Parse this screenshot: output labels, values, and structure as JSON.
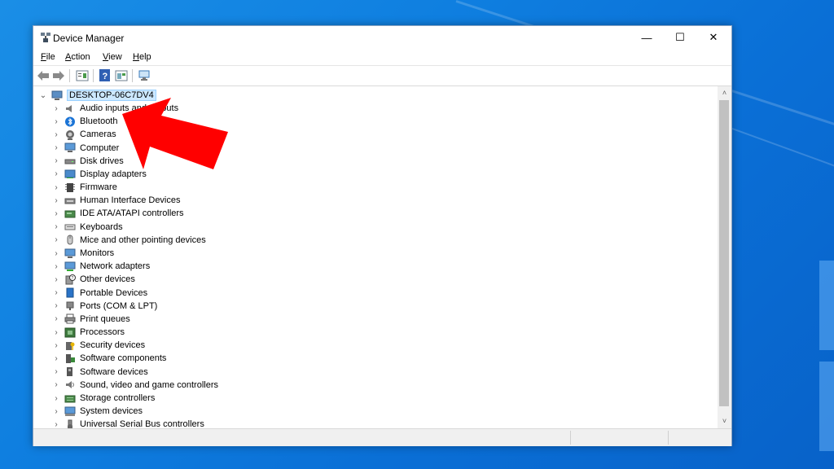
{
  "window": {
    "title": "Device Manager",
    "minimize_glyph": "—",
    "maximize_glyph": "☐",
    "close_glyph": "✕"
  },
  "menubar": [
    {
      "label": "File",
      "hotkey": "F",
      "rest": "ile"
    },
    {
      "label": "Action",
      "hotkey": "A",
      "rest": "ction"
    },
    {
      "label": "View",
      "hotkey": "V",
      "rest": "iew"
    },
    {
      "label": "Help",
      "hotkey": "H",
      "rest": "elp"
    }
  ],
  "toolbar": {
    "icons": [
      "back-arrow-icon",
      "forward-arrow-icon",
      "properties-icon",
      "help-icon",
      "show-hide-icon",
      "scan-hardware-icon"
    ]
  },
  "tree": {
    "root": {
      "label": "DESKTOP-06C7DV4",
      "expanded": true
    },
    "items": [
      {
        "label": "Audio inputs and outputs",
        "icon": "audio-icon"
      },
      {
        "label": "Bluetooth",
        "icon": "bluetooth-icon"
      },
      {
        "label": "Cameras",
        "icon": "camera-icon"
      },
      {
        "label": "Computer",
        "icon": "computer-icon"
      },
      {
        "label": "Disk drives",
        "icon": "disk-drive-icon"
      },
      {
        "label": "Display adapters",
        "icon": "display-adapter-icon"
      },
      {
        "label": "Firmware",
        "icon": "firmware-icon"
      },
      {
        "label": "Human Interface Devices",
        "icon": "hid-icon"
      },
      {
        "label": "IDE ATA/ATAPI controllers",
        "icon": "ide-controller-icon"
      },
      {
        "label": "Keyboards",
        "icon": "keyboard-icon"
      },
      {
        "label": "Mice and other pointing devices",
        "icon": "mouse-icon"
      },
      {
        "label": "Monitors",
        "icon": "monitor-icon"
      },
      {
        "label": "Network adapters",
        "icon": "network-adapter-icon"
      },
      {
        "label": "Other devices",
        "icon": "other-devices-icon"
      },
      {
        "label": "Portable Devices",
        "icon": "portable-device-icon"
      },
      {
        "label": "Ports (COM & LPT)",
        "icon": "port-icon"
      },
      {
        "label": "Print queues",
        "icon": "printer-icon"
      },
      {
        "label": "Processors",
        "icon": "processor-icon"
      },
      {
        "label": "Security devices",
        "icon": "security-device-icon"
      },
      {
        "label": "Software components",
        "icon": "software-component-icon"
      },
      {
        "label": "Software devices",
        "icon": "software-device-icon"
      },
      {
        "label": "Sound, video and game controllers",
        "icon": "sound-icon"
      },
      {
        "label": "Storage controllers",
        "icon": "storage-controller-icon"
      },
      {
        "label": "System devices",
        "icon": "system-device-icon"
      },
      {
        "label": "Universal Serial Bus controllers",
        "icon": "usb-icon"
      }
    ]
  },
  "scrollbar": {
    "up_glyph": "˄",
    "down_glyph": "˅"
  },
  "colors": {
    "selection": "#cce8ff",
    "annotation_arrow": "#ff0000",
    "desktop": "#0f7fe0"
  }
}
